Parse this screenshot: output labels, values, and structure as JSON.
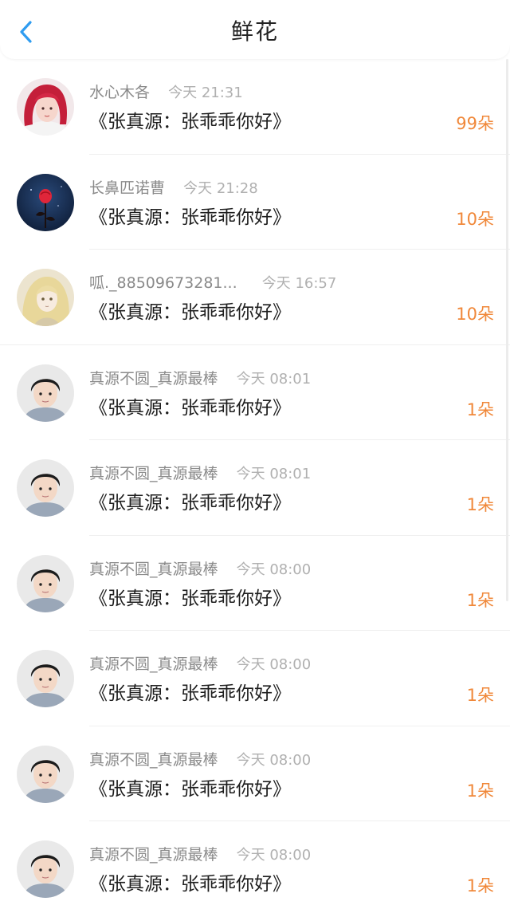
{
  "header": {
    "title": "鲜花",
    "back_icon": "chevron-left-icon",
    "back_color": "#2f9cf0"
  },
  "colors": {
    "amount": "#f0883a",
    "nickname": "#8a8a8a",
    "time": "#b0b0b0"
  },
  "records": [
    {
      "nickname": "水心木各",
      "time": "今天 21:31",
      "book": "《张真源：张乖乖你好》",
      "amount": "99朵",
      "avatar": "red-hair-girl-avatar"
    },
    {
      "nickname": "长鼻匹诺曹",
      "time": "今天 21:28",
      "book": "《张真源：张乖乖你好》",
      "amount": "10朵",
      "avatar": "rose-avatar"
    },
    {
      "nickname": "呱._88509673281...",
      "time": "今天 16:57",
      "book": "《张真源：张乖乖你好》",
      "amount": "10朵",
      "avatar": "anime-girl-avatar"
    },
    {
      "nickname": "真源不圆_真源最棒",
      "time": "今天 08:01",
      "book": "《张真源：张乖乖你好》",
      "amount": "1朵",
      "avatar": "boy-photo-avatar"
    },
    {
      "nickname": "真源不圆_真源最棒",
      "time": "今天 08:01",
      "book": "《张真源：张乖乖你好》",
      "amount": "1朵",
      "avatar": "boy-photo-avatar"
    },
    {
      "nickname": "真源不圆_真源最棒",
      "time": "今天 08:00",
      "book": "《张真源：张乖乖你好》",
      "amount": "1朵",
      "avatar": "boy-photo-avatar"
    },
    {
      "nickname": "真源不圆_真源最棒",
      "time": "今天 08:00",
      "book": "《张真源：张乖乖你好》",
      "amount": "1朵",
      "avatar": "boy-photo-avatar"
    },
    {
      "nickname": "真源不圆_真源最棒",
      "time": "今天 08:00",
      "book": "《张真源：张乖乖你好》",
      "amount": "1朵",
      "avatar": "boy-photo-avatar"
    },
    {
      "nickname": "真源不圆_真源最棒",
      "time": "今天 08:00",
      "book": "《张真源：张乖乖你好》",
      "amount": "1朵",
      "avatar": "boy-photo-avatar"
    }
  ]
}
